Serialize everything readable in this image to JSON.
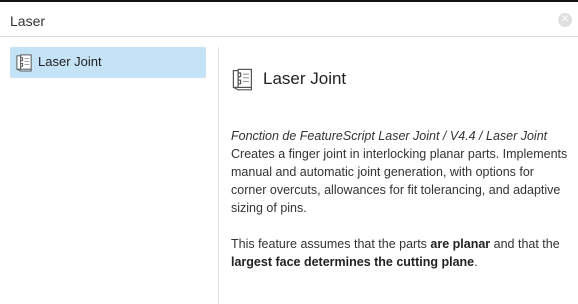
{
  "search": {
    "value": "Laser",
    "clear_icon": "clear-circle-icon"
  },
  "results": [
    {
      "label": "Laser Joint",
      "icon": "laser-joint-feature-icon",
      "selected": true
    }
  ],
  "detail": {
    "title": "Laser Joint",
    "icon": "laser-joint-feature-icon",
    "subtitle": "Fonction de FeatureScript Laser Joint / V4.4 / Laser Joint",
    "description": "Creates a finger joint in interlocking planar parts. Implements manual and automatic joint generation, with options for corner overcuts, allowances for fit tolerancing, and adaptive sizing of pins.",
    "note": {
      "part1": "This feature assumes that the parts ",
      "bold1": "are planar",
      "part2": " and that the ",
      "bold2": "largest face determines the cutting plane",
      "part3": "."
    }
  },
  "colors": {
    "selected_background": "#c5e3f6",
    "divider": "#e3e3e3",
    "text": "#333333"
  }
}
